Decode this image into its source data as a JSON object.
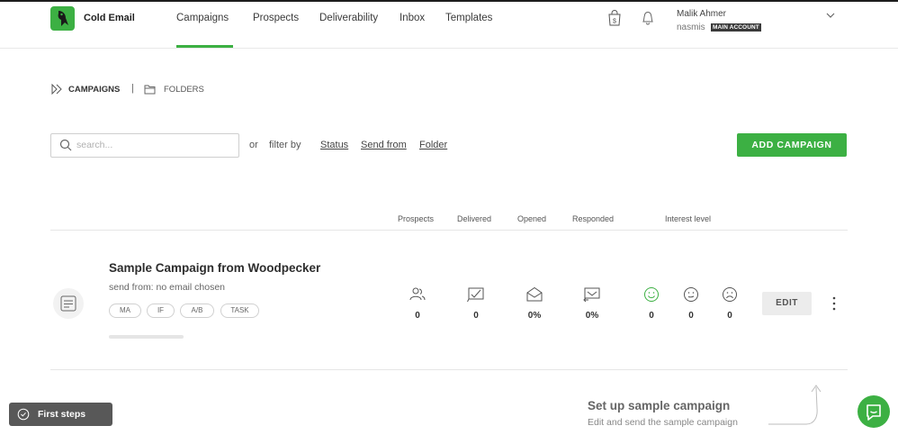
{
  "header": {
    "brand": "Cold Email",
    "nav": [
      "Campaigns",
      "Prospects",
      "Deliverability",
      "Inbox",
      "Templates"
    ],
    "active_nav": "Campaigns",
    "user_name": "Malik Ahmer",
    "user_sub": "nasmis",
    "account_badge": "MAIN ACCOUNT",
    "brand_color": "#3cb043"
  },
  "breadcrumb": {
    "campaigns": "CAMPAIGNS",
    "separator": "|",
    "folders": "FOLDERS"
  },
  "toolbar": {
    "search_placeholder": "search...",
    "or": "or",
    "filter_by": "filter by",
    "filters": [
      "Status",
      "Send from",
      "Folder"
    ],
    "add_button": "ADD CAMPAIGN"
  },
  "columns": [
    "Prospects",
    "Delivered",
    "Opened",
    "Responded",
    "Interest level"
  ],
  "campaign": {
    "title": "Sample Campaign from Woodpecker",
    "send_from_label": "send from:",
    "send_from_value": "no email chosen",
    "tags": [
      "MA",
      "IF",
      "A/B",
      "TASK"
    ],
    "stats": {
      "prospects": "0",
      "delivered": "0",
      "opened": "0%",
      "responded": "0%",
      "interested": "0",
      "maybe": "0",
      "not_interested": "0"
    },
    "edit_button": "EDIT"
  },
  "footer": {
    "first_steps": "First steps",
    "setup_title": "Set up sample campaign",
    "setup_text": "Edit and send the sample campaign"
  }
}
